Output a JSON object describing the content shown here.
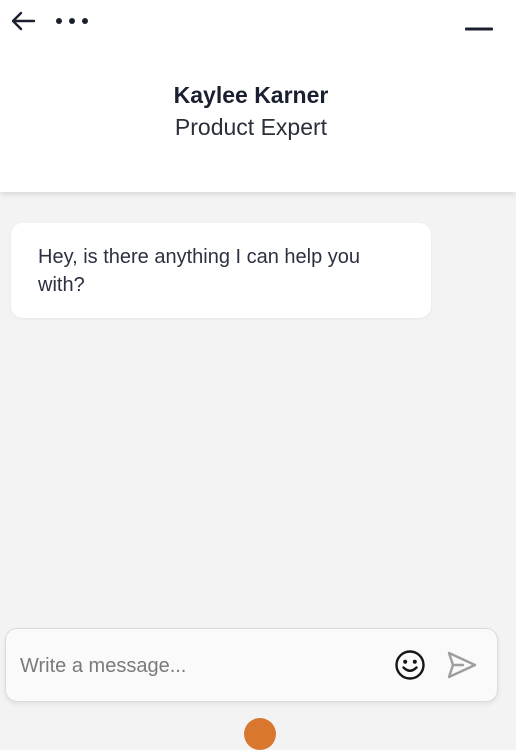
{
  "header": {
    "back_icon": "arrow-left-icon",
    "more_icon": "more-horizontal-icon",
    "minimize_icon": "minimize-icon",
    "agent_name": "Kaylee Karner",
    "agent_role": "Product Expert"
  },
  "conversation": {
    "messages": [
      {
        "sender": "agent",
        "text": "Hey, is there anything I can help you with?"
      }
    ]
  },
  "composer": {
    "placeholder": "Write a message...",
    "value": "",
    "emoji_icon": "smiley-icon",
    "send_icon": "send-icon"
  },
  "colors": {
    "header_bg": "#ffffff",
    "chat_bg": "#f3f3f3",
    "bubble_bg": "#ffffff",
    "text_primary": "#1b2030",
    "send_icon": "#9e9e9e",
    "launcher_accent": "#d9772e"
  }
}
